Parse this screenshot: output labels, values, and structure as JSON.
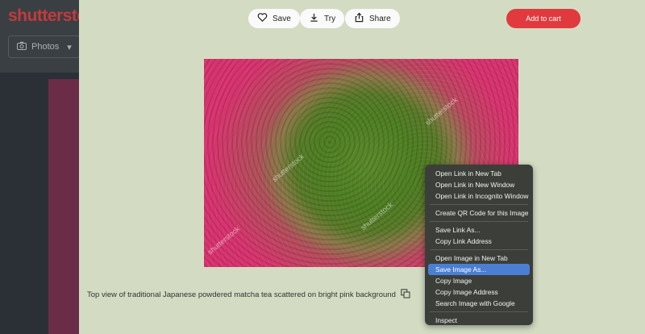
{
  "background": {
    "logo": "shutterstoc",
    "filter_label": "Photos"
  },
  "toolbar": {
    "save_label": "Save",
    "try_label": "Try",
    "share_label": "Share",
    "add_to_cart_label": "Add to cart"
  },
  "image": {
    "watermark": "shutterstock",
    "caption": "Top view of traditional Japanese powdered matcha tea scattered on bright pink background"
  },
  "context_menu": {
    "items": [
      {
        "label": "Open Link in New Tab"
      },
      {
        "label": "Open Link in New Window"
      },
      {
        "label": "Open Link in Incognito Window"
      },
      {
        "label": "Create QR Code for this Image"
      },
      {
        "label": "Save Link As..."
      },
      {
        "label": "Copy Link Address"
      },
      {
        "label": "Open Image in New Tab"
      },
      {
        "label": "Save Image As...",
        "highlighted": true
      },
      {
        "label": "Copy Image"
      },
      {
        "label": "Copy Image Address"
      },
      {
        "label": "Search Image with Google"
      },
      {
        "label": "Inspect"
      }
    ]
  },
  "colors": {
    "accent": "#e03a3e",
    "menu_highlight": "#4a7fd4",
    "modal_bg": "#d3dcc3"
  }
}
